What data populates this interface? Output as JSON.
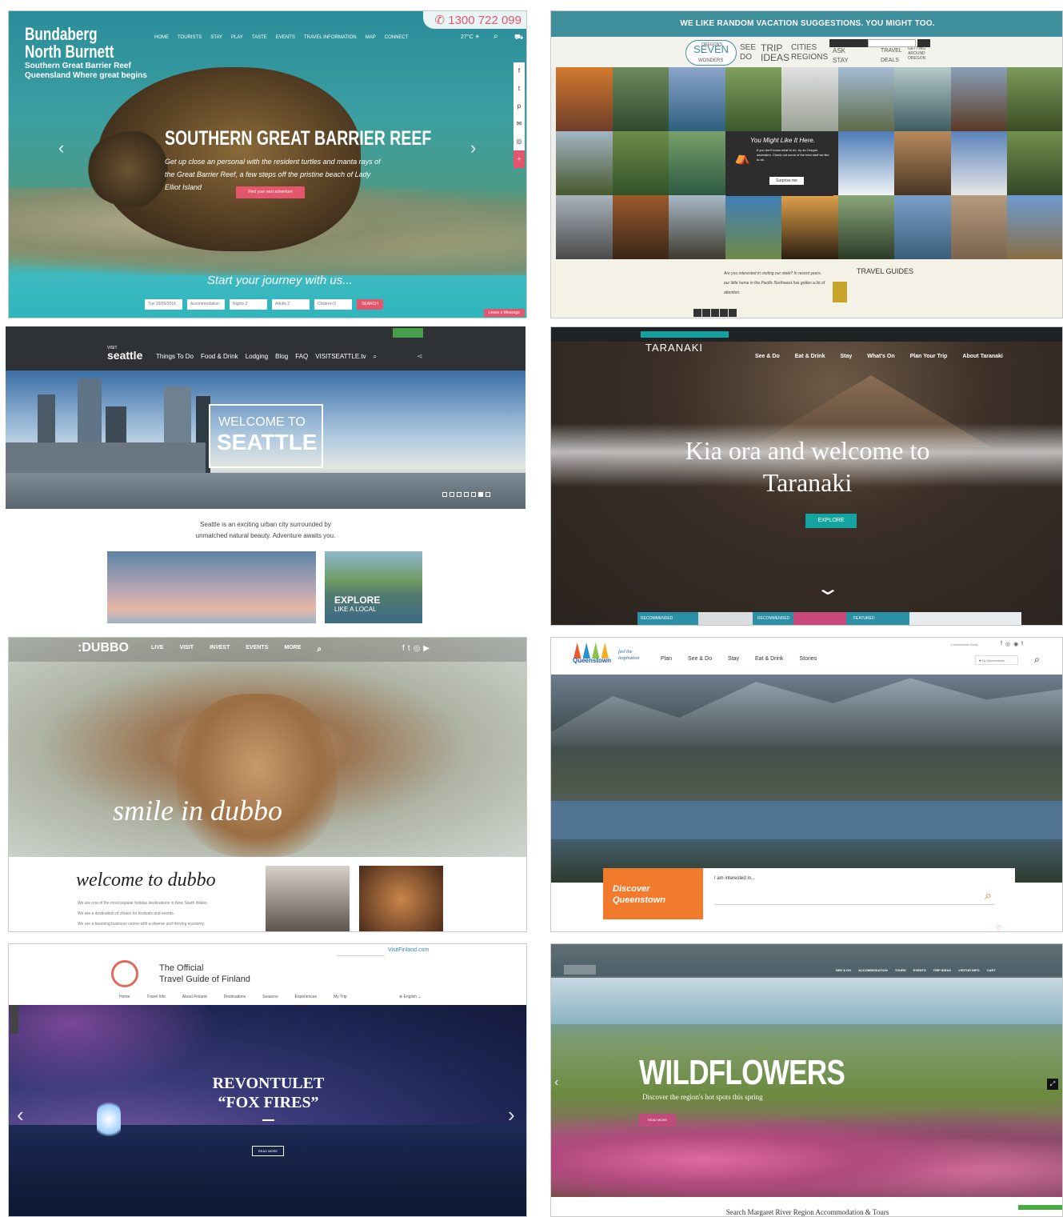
{
  "bundaberg": {
    "phone": "1300 722 099",
    "logo_line1": "Bundaberg",
    "logo_line2": "North Burnett",
    "logo_tag1": "Southern Great Barrier Reef",
    "logo_tag2": "Queensland Where great begins",
    "nav": [
      "HOME",
      "TOURISTS",
      "STAY",
      "PLAY",
      "TASTE",
      "EVENTS",
      "TRAVEL INFORMATION",
      "MAP",
      "CONNECT"
    ],
    "weather": "27°C",
    "hero_title": "SOUTHERN GREAT BARRIER REEF",
    "hero_sub": "Get up close an personal with the resident turtles and manta rays of the Great Barrier Reef, a few steps off the pristine beach of Lady Elliot Island",
    "cta": "Find your next adventure",
    "journey": "Start your journey with us...",
    "form": [
      "Tue 20/09/2016",
      "Accommodation",
      "Nights 2",
      "Adults 2",
      "Children 0"
    ],
    "search": "SEARCH",
    "message": "Leave a Message"
  },
  "oregon": {
    "banner": "WE LIKE RANDOM VACATION SUGGESTIONS. YOU MIGHT TOO.",
    "seven": "SEVEN",
    "seven_wonders": "WONDERS",
    "oregons": "OREGON'S",
    "see_do": "SEE DO",
    "trip_ideas": "TRIP IDEAS",
    "cities_regions": "CITIES REGIONS",
    "ask_stay": "ASK STAY",
    "travel_deals": "TRAVEL DEALS",
    "getting_around": "GETTING AROUND OREGON",
    "card_title": "You Might Like It Here.",
    "card_text": "If you don't know what to do, try an Oregon adventure. Check out some of the best stuff we like to do.",
    "card_button": "Surprise me",
    "guides_title": "TRAVEL GUIDES",
    "question": "Are you interested in visiting our state? In recent years, our little home in the Pacific Northwest has gotten a lot of attention."
  },
  "seattle": {
    "brand_small": "VISIT",
    "brand": "seattle",
    "nav": [
      "Things To Do",
      "Food & Drink",
      "Lodging",
      "Blog",
      "FAQ",
      "VISITSEATTLE.tv"
    ],
    "welcome_line1": "WELCOME TO",
    "welcome_line2": "SEATTLE",
    "tagline1": "Seattle is an exciting urban city surrounded by",
    "tagline2": "unmatched natural beauty. Adventure awaits you.",
    "explore_line1": "EXPLORE",
    "explore_line2": "LIKE A LOCAL"
  },
  "taranaki": {
    "logo": "TARANAKI",
    "nav": [
      "See & Do",
      "Eat & Drink",
      "Stay",
      "What's On",
      "Plan Your Trip",
      "About Taranaki"
    ],
    "hero_line1": "Kia ora and welcome to",
    "hero_line2": "Taranaki",
    "cta": "EXPLORE",
    "tags": [
      "RECOMMENDED",
      "RECOMMENDED",
      "FEATURED"
    ]
  },
  "dubbo": {
    "logo": ":DUBBO",
    "nav": [
      "LIVE",
      "VISIT",
      "INVEST",
      "EVENTS",
      "MORE"
    ],
    "script": "smile in dubbo",
    "welcome": "welcome to dubbo",
    "line1": "We are one of the most popular holiday destinations in New South Wales.",
    "line2": "We are a destination of choice for festivals and events.",
    "line3": "We are a booming business centre with a diverse and thriving economy."
  },
  "queenstown": {
    "logo": "Queenstown",
    "tagline": "feel the inspiration",
    "nav": [
      "Plan",
      "See & Do",
      "Stay",
      "Eat & Drink",
      "Stories"
    ],
    "topright": "Conferences Study",
    "myq": "My Queenstown",
    "discover1": "Discover",
    "discover2": "Queenstown",
    "interest": "I am interested in..."
  },
  "finland": {
    "official1": "The Official",
    "official2": "Travel Guide of Finland",
    "site": "VisitFinland.com",
    "nav": [
      "Home",
      "Travel Info",
      "About Finland",
      "Destinations",
      "Seasons",
      "Experiences",
      "My Trip"
    ],
    "lang": "English",
    "hero1": "REVONTULET",
    "hero2": "“FOX FIRES”",
    "cta": "READ MORE"
  },
  "margaret": {
    "nav": [
      "SEE & DO",
      "ACCOMMODATION",
      "TOURS",
      "EVENTS",
      "TRIP IDEAS",
      "VISITOR INFO",
      "CART"
    ],
    "hero": "WILDFLOWERS",
    "sub": "Discover the region's hot spots this spring",
    "cta": "READ MORE",
    "search": "Search Margaret River Region Accommodation & Tours"
  }
}
